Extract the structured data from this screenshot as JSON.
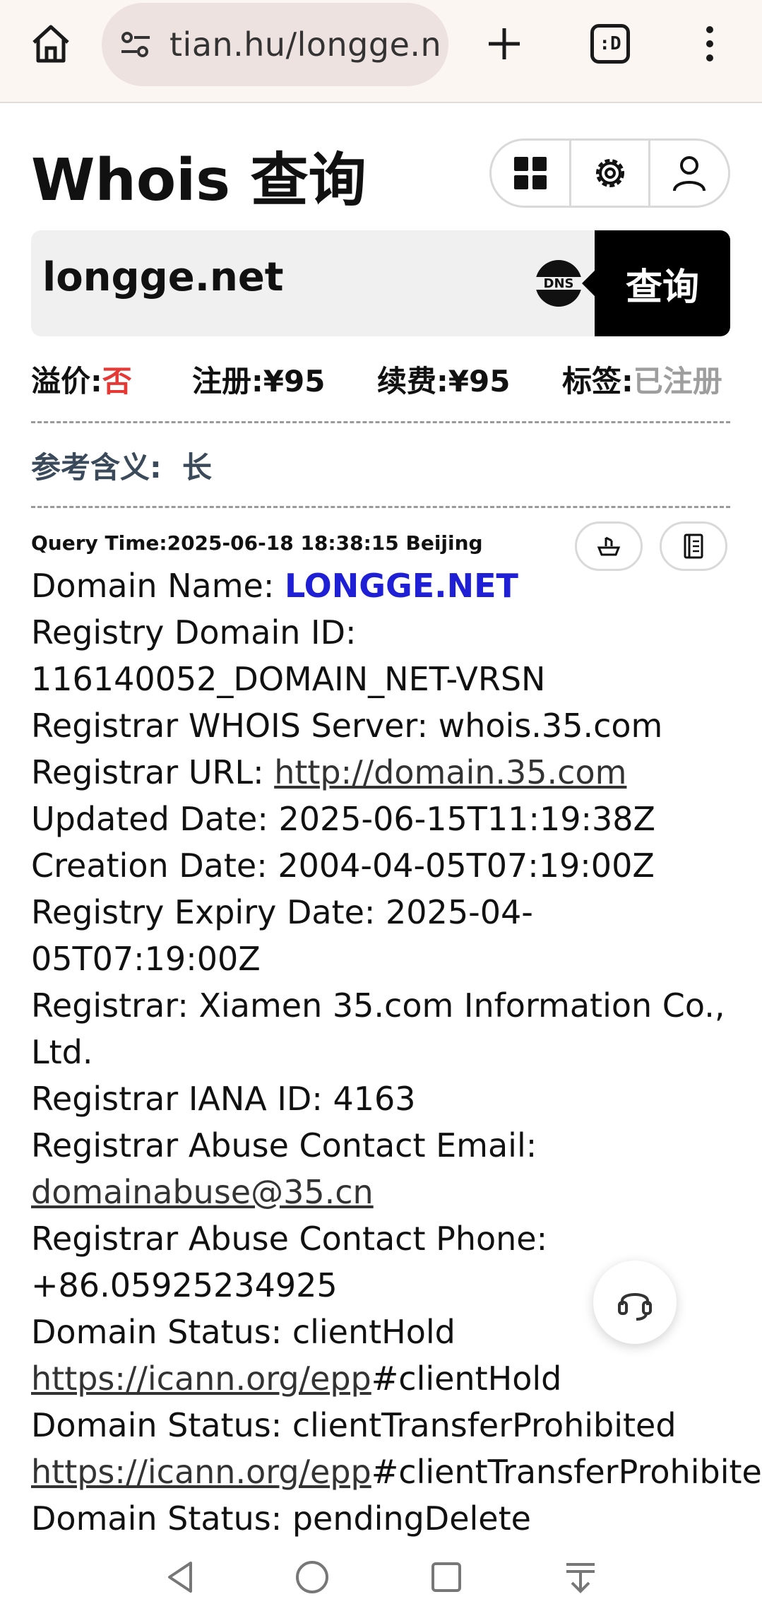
{
  "browser": {
    "url": "tian.hu/longge.n",
    "tabs_label": ":D"
  },
  "page": {
    "title": "Whois 查询"
  },
  "search": {
    "query": "longge.net",
    "button": "查询"
  },
  "prices": {
    "premium_label": "溢价:",
    "premium_value": "否",
    "register_label": "注册:",
    "register_value": "¥95",
    "renew_label": "续费:",
    "renew_value": "¥95",
    "tag_label": "标签:",
    "tag_value": "已注册"
  },
  "meaning": {
    "label": "参考含义:",
    "value": "长"
  },
  "whois": {
    "query_time": "Query Time:2025-06-18 18:38:15 Beijing",
    "domain_name_label": "Domain Name: ",
    "domain_name": "LONGGE.NET",
    "registry_id_label": "Registry Domain ID:",
    "registry_id": "116140052_DOMAIN_NET-VRSN",
    "whois_server": "Registrar WHOIS Server: whois.35.com",
    "registrar_url_label": "Registrar URL: ",
    "registrar_url": "http://domain.35.com",
    "updated": "Updated Date: 2025-06-15T11:19:38Z",
    "created": "Creation Date: 2004-04-05T07:19:00Z",
    "expiry_1": "Registry Expiry Date: 2025-04-",
    "expiry_2": "05T07:19:00Z",
    "registrar_1": "Registrar: Xiamen 35.com Information Co.,",
    "registrar_2": "Ltd.",
    "iana": "Registrar IANA ID: 4163",
    "abuse_email_label": "Registrar Abuse Contact Email:",
    "abuse_email": "domainabuse@35.cn",
    "abuse_phone_label": "Registrar Abuse Contact Phone:",
    "abuse_phone": "+86.05925234925",
    "status_1": "Domain Status: clientHold",
    "status_1_link": "https://icann.org/epp",
    "status_1_suffix": "#clientHold",
    "status_2": "Domain Status: clientTransferProhibited",
    "status_2_link": "https://icann.org/epp",
    "status_2_suffix": "#clientTransferProhibited",
    "status_3": "Domain Status: pendingDelete"
  }
}
